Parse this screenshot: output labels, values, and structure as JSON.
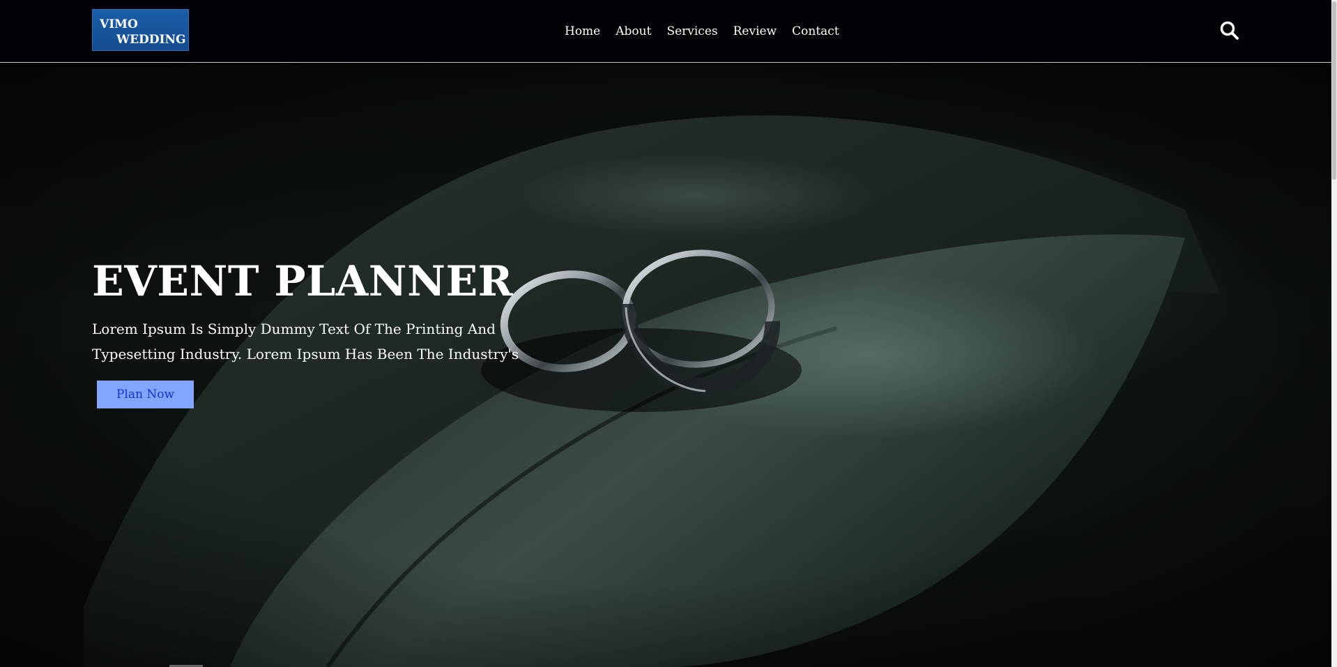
{
  "brand": {
    "logo_line1": "VIMO",
    "logo_line2": "WEDDING",
    "logo_color": "#1c5ea9"
  },
  "nav": {
    "items": [
      {
        "label": "Home"
      },
      {
        "label": "About"
      },
      {
        "label": "Services"
      },
      {
        "label": "Review"
      },
      {
        "label": "Contact"
      }
    ],
    "search_icon": "search-icon"
  },
  "hero": {
    "title": "EVENT PLANNER",
    "subtitle": "Lorem Ipsum Is Simply Dummy Text Of The Printing And Typesetting Industry. Lorem Ipsum Has Been The Industry's",
    "cta_label": "Plan Now",
    "cta_bg": "#82a6ff",
    "cta_text_color": "#1a2fd1",
    "image": "wedding-rings-on-leaf"
  }
}
